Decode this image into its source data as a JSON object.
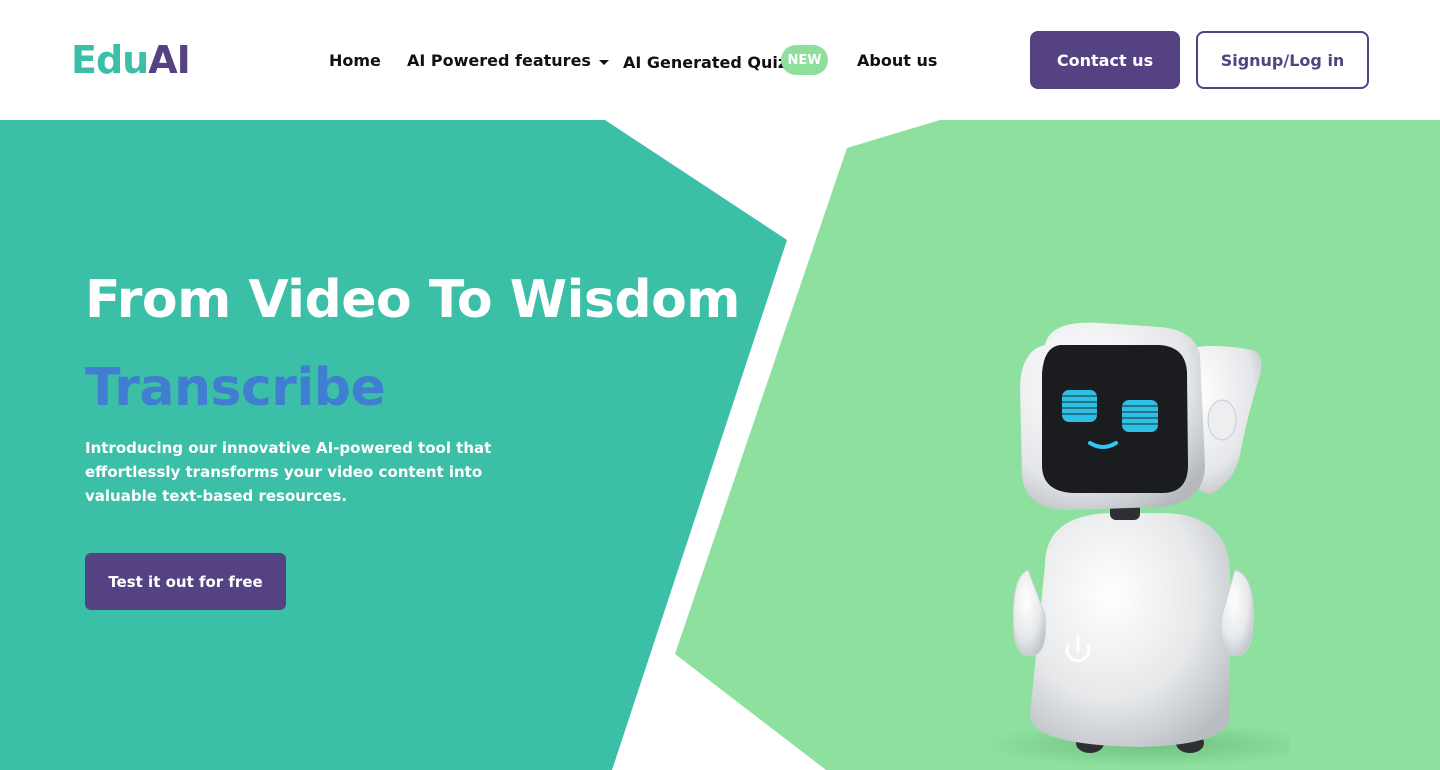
{
  "brand": {
    "logo_edu": "Edu",
    "logo_ai": "AI"
  },
  "nav": {
    "home": "Home",
    "features": "AI Powered features",
    "quiz": "AI Generated Quiz",
    "quiz_badge": "NEW",
    "about": "About us"
  },
  "actions": {
    "contact": "Contact us",
    "signup": "Signup/Log in"
  },
  "hero": {
    "title": "From Video To Wisdom",
    "subtitle": "Transcribe",
    "description": "Introducing our innovative AI-powered tool that effortlessly transforms your video content into valuable text-based resources.",
    "cta": "Test it out for free"
  },
  "icons": [
    "chevron-down-icon",
    "power-icon"
  ],
  "colors": {
    "brand_teal": "#3bbfa6",
    "brand_purple": "#554283",
    "hero_green": "#8ee09e",
    "subtitle_blue": "#3f7ed0",
    "badge_green": "#8edf9c"
  }
}
